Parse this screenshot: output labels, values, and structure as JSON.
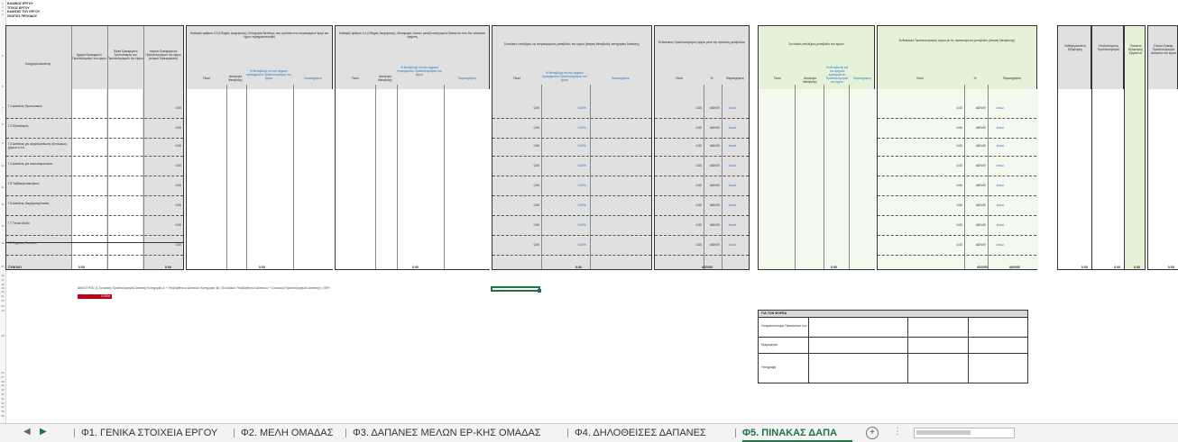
{
  "meta": {
    "lines": [
      "ΚΩΔΙΚΟΣ ΕΡΓΟΥ",
      "ΤΙΤΛΟΣ ΕΡΓΟΥ",
      "ΚΑΘ/ΣΗΣ ΤΟΥ ΕΡΓΟΥ",
      "ΣΚΟΠΟΣ ΠΡΟΟΔΟΥ"
    ]
  },
  "row_numbers": [
    "1",
    "2",
    "3",
    "4",
    "5",
    "6",
    "7",
    "8",
    "9",
    "10",
    "11",
    "12",
    "13",
    "14",
    "15",
    "16",
    "17",
    "18",
    "19",
    "20",
    "21",
    "22",
    "23",
    "24",
    "25",
    "26",
    "27",
    "28",
    "29",
    "30",
    "31",
    "32",
    "33",
    "34",
    "35",
    "36"
  ],
  "left_table": {
    "col1": "Κατηγορία Δαπάνης",
    "col2": "Αρχικό Εγκεκριμένο Προϋπολογισμό του έργου",
    "col3": "Τελικό Εγκεκριμένο Τροποποίηση του Προϋπολογισμού του έργου",
    "col4": "Ιτσμένο Εγκεκριμένου Προϋπολογισμού του έργου (τελικού Εγκεκριμένου)"
  },
  "rows": [
    {
      "label": "Γ.1 Δαπάνες Προσωπικού",
      "total": "0.00"
    },
    {
      "label": "Γ.2 Εξοπλισμός",
      "total": "0.00"
    },
    {
      "label": "Γ.3 Δαπάνες για αγορά/μίσθωση εξοπλισμού, χώρων κ.λπ.",
      "total": "0.00"
    },
    {
      "label": "Γ.4 Δαπάνες για αναλώσιμα/υλικά",
      "total": "0.00"
    },
    {
      "label": "Γ.5 Ταξίδια/μετακινήσεις",
      "total": "0.00"
    },
    {
      "label": "Γ.6 Δαπάνες διαχείρισης/λοιπές",
      "total": "0.00"
    },
    {
      "label": "Γ.7 Γενικά έξοδα",
      "total": "0.00"
    },
    {
      "label": "Γ.8 Έμμεσες δαπάνες",
      "total": "0.00"
    }
  ],
  "total_row": {
    "label": "ΣΥΝΟΛΟ",
    "v1": "0.00",
    "v2": "0.00",
    "v3": "0.00",
    "v4": "0.00",
    "err": "#DIV/0!"
  },
  "sections": {
    "s1": "Καθαρές άρθρου 3.3 (Οδηγίες Διαχείρισης). Κατηγορία δαπάνης που εμπίπτει στο συγκεκριμένο έργο και έχουν πραγματοποιηθεί",
    "s2": "Καθαρές άρθρου 3.4 (Οδηγίες Διαχείρισης). Μεταφορές ποσών μεταξύ κατηγοριών δαπανών που δεν απαιτούν έγκριση",
    "s3": "Συνολικές επιλεξιμες ως ενεγκεκριμένες μεταβολές του έργου (Αιτηση Μεταβολής κατηγορίας δαπάνης)",
    "s4": "Ενδεικτικός Προϋπολογισμός έργου μετά την πρόταση μεταβολών",
    "s5": "Συνολικές επιλεξιμες μεταβολές του έργου",
    "s6": "Ενδεικτικός Προϋπολογισμός έργου με τις προτεινόμενες μεταβολές (Αιτηση Μεταβολής)",
    "s7": "Καθαρή Δαπάνη Εξόφλησης",
    "s8": "Υπολοιπόμενος Προϋπολογισμός",
    "s9": "Ποσοστό Εξόφλησης Εργασιών",
    "s10": "Σύνολο Εγκεκρ. Προϋπολογισμού Δαπανών του έργου"
  },
  "sub_cols": {
    "amount": "Ποσό",
    "reason": "Αιτιολογία Μεταβολής",
    "pct": "% Μεταβολής επί του αρχικού εγκεκριμένου Προϋπολογισμού του έργου",
    "remarks": "Παρατηρήσεις",
    "pct_sign": "%"
  },
  "cells": {
    "zero": "0.00",
    "pct": "0.00%",
    "div0": "#DIV/0!",
    "link": "Αιτιολ"
  },
  "formula_text": "ΑΝΙΣΟΤΗΤΑ: (Σ Συνολικής Προϋπολογισμού Δαπάνης Κατηγορίας Α + Υποβληθέντων Δαπανών Κατηγορίας Β) / (Συνολικού Υποβληθέντων Δαπανών + Συνολικού Προϋπολογισμού Δαπάνης) < 50%",
  "red_value": "0.00%",
  "signature": {
    "title": "ΓΙΑ ΤΟΝ ΦΟΡΕΑ",
    "rows": [
      "Ονοματεπώνυμο Προσώπου/ Ιων",
      "Ημερομηνία",
      "Υπογραφή"
    ]
  },
  "tabs": [
    {
      "label": "Φ1. ΓΕΝΙΚΑ ΣΤΟΙΧΕΙΑ ΕΡΓΟΥ"
    },
    {
      "label": "Φ2. ΜΕΛΗ ΟΜΑΔΑΣ"
    },
    {
      "label": "Φ3. ΔΑΠΑΝΕΣ ΜΕΛΩΝ ΕΡ-ΚΗΣ ΟΜΑΔΑΣ"
    },
    {
      "label": "Φ4. ΔΗΛΟΘΕΙΣΕΣ ΔΑΠΑΝΕΣ"
    },
    {
      "label": "Φ5. ΠΙΝΑΚΑΣ ΔΑΠΑ"
    }
  ],
  "icons": {
    "prev": "◀",
    "next": "▶",
    "add": "+",
    "more": "⋮"
  },
  "colors": {
    "accent": "#217346",
    "green_fill": "#e6f2d8",
    "red": "#c0001a"
  }
}
